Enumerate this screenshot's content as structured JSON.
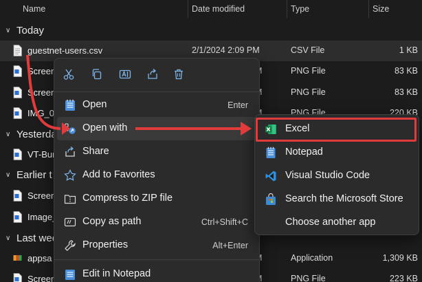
{
  "columns": {
    "name": "Name",
    "date": "Date modified",
    "type": "Type",
    "size": "Size"
  },
  "groups": {
    "today": "Today",
    "yesterday": "Yesterda",
    "earlier": "Earlier t",
    "lastweek": "Last wee"
  },
  "files": [
    {
      "name": "guestnet-users.csv",
      "date": "2/1/2024 2:09 PM",
      "type": "CSV File",
      "size": "1 KB"
    },
    {
      "name": "Screen",
      "date": "M",
      "type": "PNG File",
      "size": "83 KB"
    },
    {
      "name": "Screen",
      "date": "M",
      "type": "PNG File",
      "size": "83 KB"
    },
    {
      "name": "IMG_0",
      "date": "M",
      "type": "PNG File",
      "size": "220 KB"
    },
    {
      "name": "VT-Bur",
      "date": "",
      "type": "",
      "size": ""
    },
    {
      "name": "Screen",
      "date": "",
      "type": "",
      "size": ""
    },
    {
      "name": "Image_",
      "date": "",
      "type": "",
      "size": ""
    },
    {
      "name": "appsa",
      "date": "M",
      "type": "Application",
      "size": "1,309 KB"
    },
    {
      "name": "Screen",
      "date": "M",
      "type": "PNG File",
      "size": "223 KB"
    }
  ],
  "context_menu": {
    "items": [
      {
        "label": "Open",
        "shortcut": "Enter"
      },
      {
        "label": "Open with",
        "shortcut": ""
      },
      {
        "label": "Share",
        "shortcut": ""
      },
      {
        "label": "Add to Favorites",
        "shortcut": ""
      },
      {
        "label": "Compress to ZIP file",
        "shortcut": ""
      },
      {
        "label": "Copy as path",
        "shortcut": "Ctrl+Shift+C"
      },
      {
        "label": "Properties",
        "shortcut": "Alt+Enter"
      },
      {
        "label": "Edit in Notepad",
        "shortcut": ""
      }
    ],
    "open_with_arrow": "›"
  },
  "submenu": {
    "items": [
      {
        "label": "Excel"
      },
      {
        "label": "Notepad"
      },
      {
        "label": "Visual Studio Code"
      },
      {
        "label": "Search the Microsoft Store"
      },
      {
        "label": "Choose another app"
      }
    ]
  },
  "colors": {
    "background": "#1c1c1c",
    "menu": "#2b2b2b",
    "annotation_red": "#e23b3b",
    "excel_green": "#107c41",
    "notepad_blue": "#4a8fd9",
    "vscode_blue": "#2f8fe0"
  }
}
